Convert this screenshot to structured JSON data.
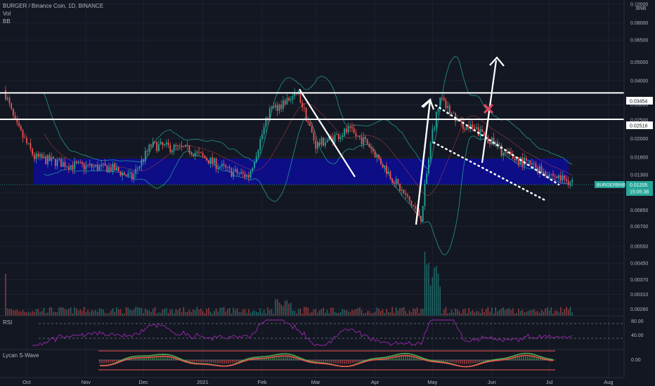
{
  "header": {
    "title": "BURGER / Binance Coin, 1D, BINANCE",
    "vol_label": "Vol",
    "bb_label": "BB"
  },
  "price_axis": {
    "unit": "BNB",
    "ticks": [
      "0.10000",
      "0.08000",
      "0.06500",
      "0.05000",
      "0.04000",
      "0.03000",
      "0.02500",
      "0.02000",
      "0.01600",
      "0.01300",
      "0.01050",
      "0.00850",
      "0.00700",
      "0.00550",
      "0.00450",
      "0.00370",
      "0.00310",
      "0.00260"
    ],
    "marked_levels": [
      "0.03454",
      "0.02518"
    ],
    "symbol_tag": "BURGERBNB",
    "last_price": "0.01205",
    "countdown": "15:05:38"
  },
  "time_axis": {
    "labels": [
      "Oct",
      "Nov",
      "Dec",
      "2021",
      "Feb",
      "Mar",
      "Apr",
      "May",
      "Jun",
      "Jul",
      "Aug"
    ]
  },
  "rsi": {
    "label": "RSI",
    "ticks": [
      "80.00",
      "40.00"
    ]
  },
  "wave": {
    "label": "Lycan S-Wave",
    "ticks": [
      "0.00"
    ]
  },
  "colors": {
    "background": "#131722",
    "up": "#26a69a",
    "down": "#ef5350",
    "zone": "#0d0d8c",
    "bands": "#26a69a",
    "rsi": "#9c27b0",
    "annotation": "#ffffff",
    "cross": "#e0435c",
    "tag": "#26a69a"
  },
  "chart_data": {
    "type": "candlestick",
    "title": "BURGER / Binance Coin, 1D, BINANCE",
    "y_scale": "log",
    "ylim": [
      0.0024,
      0.105
    ],
    "x_range": [
      "2020-09-20",
      "2021-08-08"
    ],
    "horizontal_levels": [
      0.03454,
      0.02518
    ],
    "support_zone": {
      "from": 0.012,
      "to": 0.0163
    },
    "path_points": [
      {
        "date": "2020-09-20",
        "close": 0.034
      },
      {
        "date": "2020-09-25",
        "close": 0.024
      },
      {
        "date": "2020-10-05",
        "close": 0.016
      },
      {
        "date": "2020-10-25",
        "close": 0.0145
      },
      {
        "date": "2020-11-15",
        "close": 0.014
      },
      {
        "date": "2020-11-25",
        "close": 0.0125
      },
      {
        "date": "2020-12-05",
        "close": 0.0185
      },
      {
        "date": "2020-12-25",
        "close": 0.0175
      },
      {
        "date": "2021-01-15",
        "close": 0.0135
      },
      {
        "date": "2021-01-25",
        "close": 0.0128
      },
      {
        "date": "2021-02-05",
        "close": 0.028
      },
      {
        "date": "2021-02-20",
        "close": 0.034
      },
      {
        "date": "2021-03-01",
        "close": 0.0185
      },
      {
        "date": "2021-03-18",
        "close": 0.022
      },
      {
        "date": "2021-03-28",
        "close": 0.019
      },
      {
        "date": "2021-04-10",
        "close": 0.0125
      },
      {
        "date": "2021-04-25",
        "close": 0.0078
      },
      {
        "date": "2021-05-01",
        "close": 0.022
      },
      {
        "date": "2021-05-05",
        "close": 0.032
      },
      {
        "date": "2021-05-15",
        "close": 0.024
      },
      {
        "date": "2021-05-28",
        "close": 0.021
      },
      {
        "date": "2021-06-08",
        "close": 0.0165
      },
      {
        "date": "2021-06-20",
        "close": 0.0148
      },
      {
        "date": "2021-07-06",
        "close": 0.0125
      },
      {
        "date": "2021-07-13",
        "close": 0.01205
      }
    ]
  }
}
